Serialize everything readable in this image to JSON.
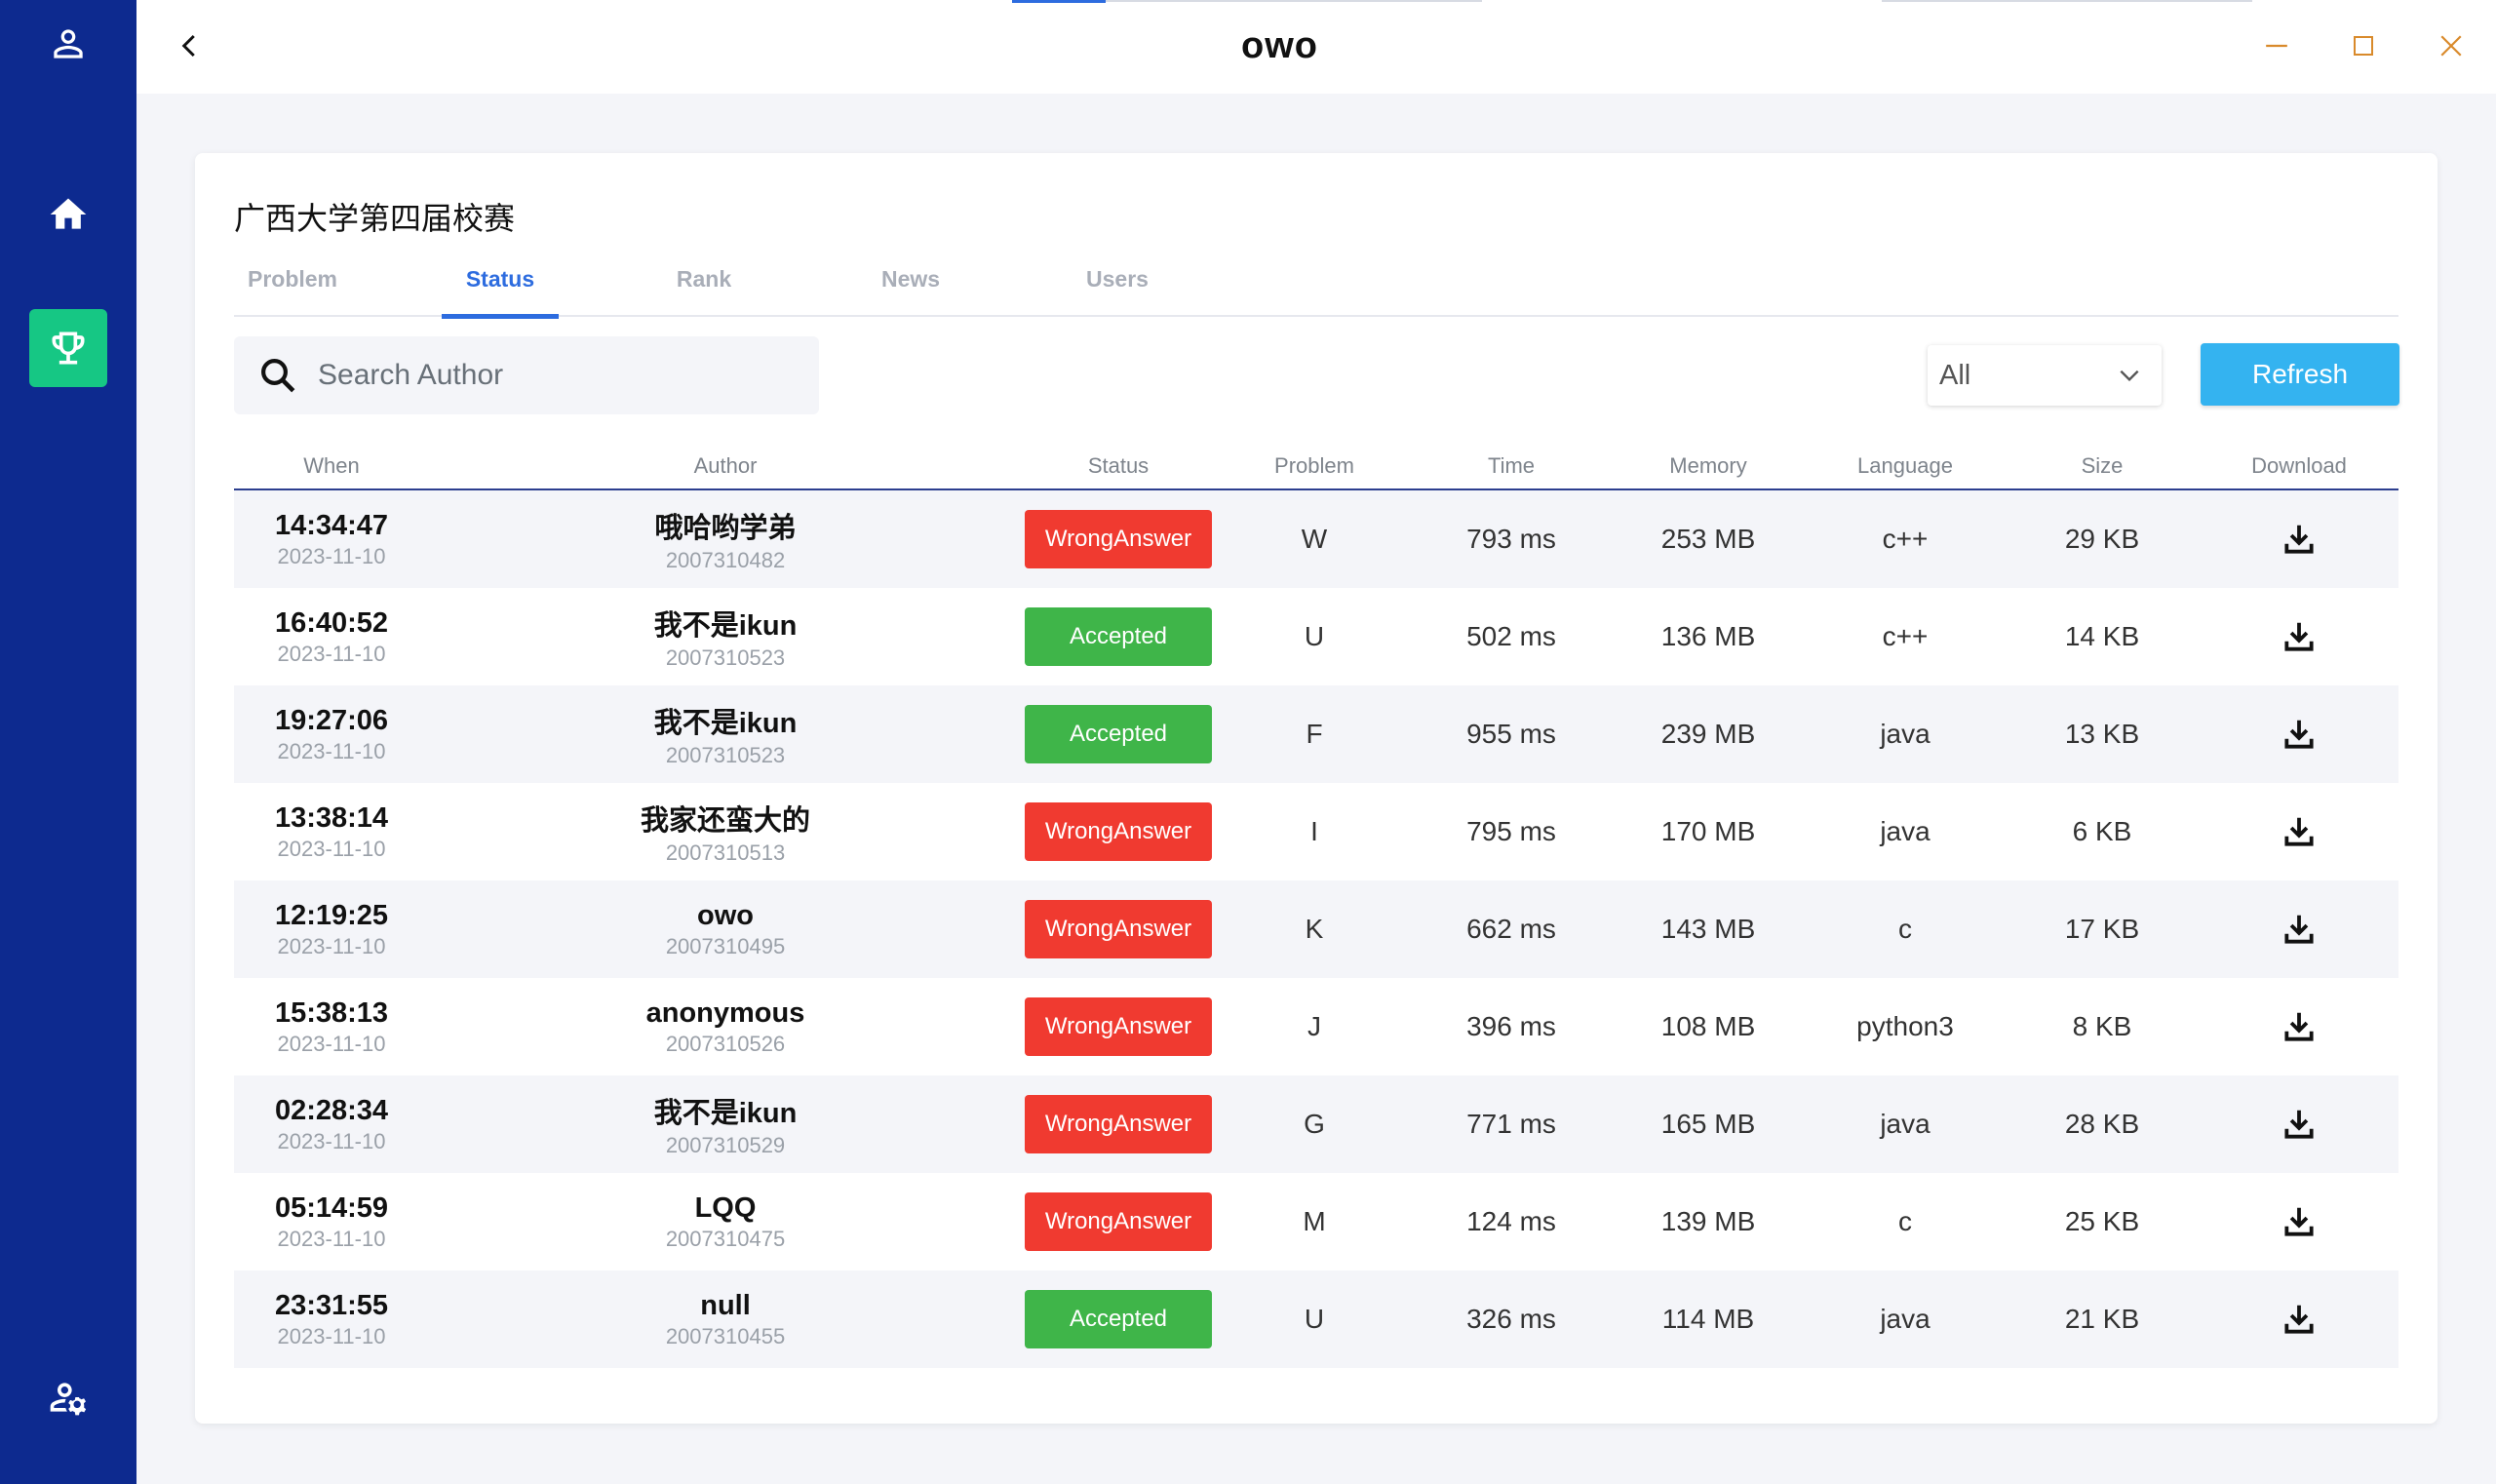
{
  "app": {
    "title": "owo"
  },
  "sidebar": {
    "items": [
      {
        "icon": "user-icon",
        "active": false
      },
      {
        "icon": "home-icon",
        "active": false
      },
      {
        "icon": "trophy-icon",
        "active": true
      },
      {
        "icon": "user-settings-icon",
        "active": false
      }
    ]
  },
  "contest": {
    "title": "广西大学第四届校赛"
  },
  "tabs": [
    {
      "label": "Problem",
      "active": false
    },
    {
      "label": "Status",
      "active": true
    },
    {
      "label": "Rank",
      "active": false
    },
    {
      "label": "News",
      "active": false
    },
    {
      "label": "Users",
      "active": false
    }
  ],
  "search": {
    "placeholder": "Search Author",
    "value": ""
  },
  "filter": {
    "selected": "All"
  },
  "refresh_label": "Refresh",
  "colors": {
    "sidebar": "#0d2a8f",
    "active_nav": "#16c784",
    "accent": "#2d6cdf",
    "wrong": "#f03a30",
    "accepted": "#3fb549",
    "refresh": "#34b3f0"
  },
  "table": {
    "headers": [
      "When",
      "Author",
      "Status",
      "Problem",
      "Time",
      "Memory",
      "Language",
      "Size",
      "Download"
    ],
    "rows": [
      {
        "time": "14:34:47",
        "date": "2023-11-10",
        "author": "哦哈哟学弟",
        "id": "2007310482",
        "status": "WrongAnswer",
        "problem": "W",
        "runtime": "793 ms",
        "memory": "253 MB",
        "language": "c++",
        "size": "29 KB"
      },
      {
        "time": "16:40:52",
        "date": "2023-11-10",
        "author": "我不是ikun",
        "id": "2007310523",
        "status": "Accepted",
        "problem": "U",
        "runtime": "502 ms",
        "memory": "136 MB",
        "language": "c++",
        "size": "14 KB"
      },
      {
        "time": "19:27:06",
        "date": "2023-11-10",
        "author": "我不是ikun",
        "id": "2007310523",
        "status": "Accepted",
        "problem": "F",
        "runtime": "955 ms",
        "memory": "239 MB",
        "language": "java",
        "size": "13 KB"
      },
      {
        "time": "13:38:14",
        "date": "2023-11-10",
        "author": "我家还蛮大的",
        "id": "2007310513",
        "status": "WrongAnswer",
        "problem": "I",
        "runtime": "795 ms",
        "memory": "170 MB",
        "language": "java",
        "size": "6 KB"
      },
      {
        "time": "12:19:25",
        "date": "2023-11-10",
        "author": "owo",
        "id": "2007310495",
        "status": "WrongAnswer",
        "problem": "K",
        "runtime": "662 ms",
        "memory": "143 MB",
        "language": "c",
        "size": "17 KB"
      },
      {
        "time": "15:38:13",
        "date": "2023-11-10",
        "author": "anonymous",
        "id": "2007310526",
        "status": "WrongAnswer",
        "problem": "J",
        "runtime": "396 ms",
        "memory": "108 MB",
        "language": "python3",
        "size": "8 KB"
      },
      {
        "time": "02:28:34",
        "date": "2023-11-10",
        "author": "我不是ikun",
        "id": "2007310529",
        "status": "WrongAnswer",
        "problem": "G",
        "runtime": "771 ms",
        "memory": "165 MB",
        "language": "java",
        "size": "28 KB"
      },
      {
        "time": "05:14:59",
        "date": "2023-11-10",
        "author": "LQQ",
        "id": "2007310475",
        "status": "WrongAnswer",
        "problem": "M",
        "runtime": "124 ms",
        "memory": "139 MB",
        "language": "c",
        "size": "25 KB"
      },
      {
        "time": "23:31:55",
        "date": "2023-11-10",
        "author": "null",
        "id": "2007310455",
        "status": "Accepted",
        "problem": "U",
        "runtime": "326 ms",
        "memory": "114 MB",
        "language": "java",
        "size": "21 KB"
      }
    ]
  }
}
